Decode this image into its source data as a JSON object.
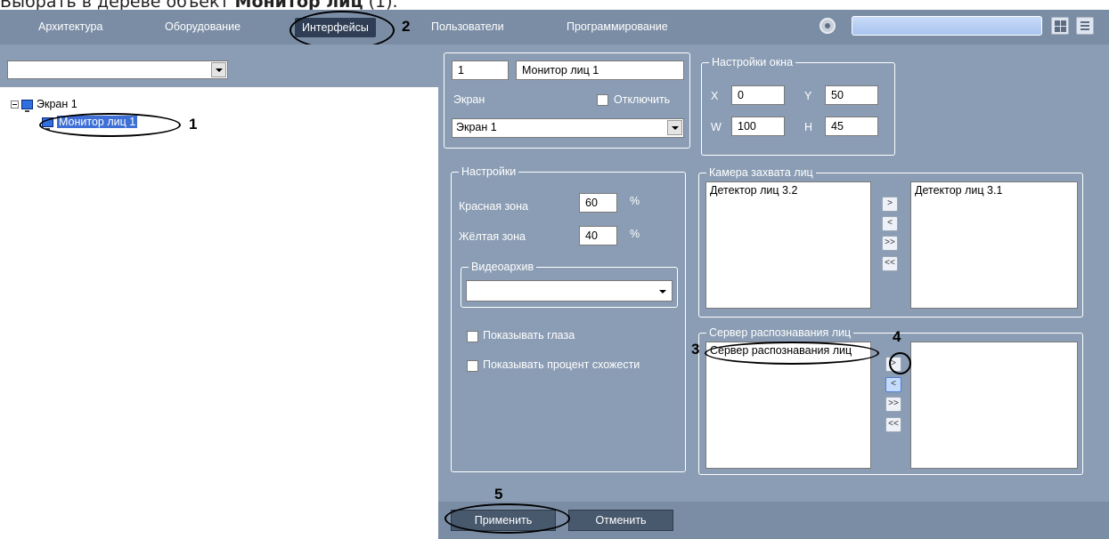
{
  "caption": {
    "prefix": "Выбрать в дереве объект ",
    "bold": "Монитор лиц",
    "suffix": " (1)."
  },
  "menu": {
    "items": [
      "Архитектура",
      "Оборудование",
      "Интерфейсы",
      "Пользователи",
      "Программирование"
    ],
    "active": "Интерфейсы"
  },
  "callouts": {
    "n1": "1",
    "n2": "2",
    "n3": "3",
    "n4": "4",
    "n5": "5"
  },
  "tree": {
    "root": "Экран 1",
    "child": "Монитор лиц 1"
  },
  "object": {
    "id": "1",
    "name": "Монитор лиц 1",
    "screen_label": "Экран",
    "disable_label": "Отключить",
    "screen_value": "Экран 1"
  },
  "window_settings": {
    "title": "Настройки окна",
    "x_label": "X",
    "x": "0",
    "y_label": "Y",
    "y": "50",
    "w_label": "W",
    "w": "100",
    "h_label": "H",
    "h": "45"
  },
  "settings": {
    "title": "Настройки",
    "red_zone_label": "Красная зона",
    "red_zone": "60",
    "yellow_zone_label": "Жёлтая зона",
    "yellow_zone": "40",
    "percent": "%",
    "archive_title": "Видеоархив",
    "archive_value": "",
    "show_eyes": "Показывать глаза",
    "show_percent": "Показывать процент схожести"
  },
  "capture_cameras": {
    "title": "Камера захвата лиц",
    "available": [
      "Детектор лиц 3.2"
    ],
    "selected": [
      "Детектор лиц 3.1"
    ]
  },
  "recognition_server": {
    "title": "Сервер распознавания лиц",
    "available": [
      "Сервер распознавания лиц"
    ],
    "selected": []
  },
  "arrow_buttons": {
    "add": ">",
    "remove": "<",
    "add_all": ">>",
    "remove_all": "<<"
  },
  "buttons": {
    "apply": "Применить",
    "cancel": "Отменить"
  }
}
